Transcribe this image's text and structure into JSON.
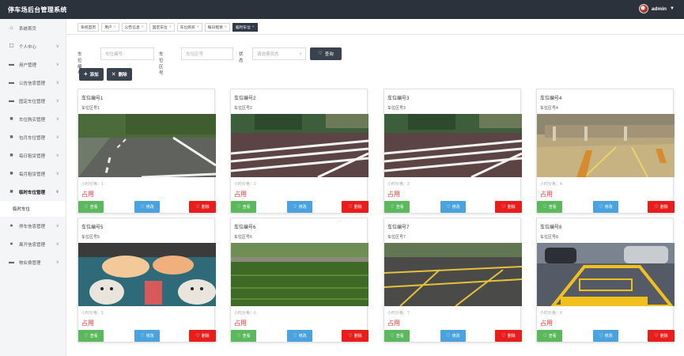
{
  "app": {
    "title": "停车场后台管理系统"
  },
  "user": {
    "name": "admin"
  },
  "sidebar": {
    "items": [
      {
        "label": "系统首页",
        "icon": "home-icon",
        "glyph": "⌂",
        "chevron": false
      },
      {
        "label": "个人中心",
        "icon": "user-icon",
        "glyph": "☐",
        "chevron": true
      },
      {
        "label": "用户管理",
        "icon": "users-icon",
        "glyph": "▬",
        "chevron": true
      },
      {
        "label": "公告信息管理",
        "icon": "notice-icon",
        "glyph": "▬",
        "chevron": true
      },
      {
        "label": "固定车位管理",
        "icon": "parking-icon",
        "glyph": "▬",
        "chevron": true
      },
      {
        "label": "车位购买管理",
        "icon": "grid-icon",
        "glyph": "■",
        "chevron": true
      },
      {
        "label": "包月车位管理",
        "icon": "grid-icon",
        "glyph": "■",
        "chevron": true
      },
      {
        "label": "每日租赁管理",
        "icon": "grid-icon",
        "glyph": "■",
        "chevron": true
      },
      {
        "label": "每月租赁管理",
        "icon": "grid-icon",
        "glyph": "■",
        "chevron": true
      },
      {
        "label": "临时车位管理",
        "icon": "grid-icon",
        "glyph": "■",
        "chevron": true,
        "active": true
      }
    ],
    "sub_item": "临时车位",
    "items_after": [
      {
        "label": "停车信息管理",
        "icon": "person-icon",
        "glyph": "●",
        "chevron": true
      },
      {
        "label": "离开信息管理",
        "icon": "exit-icon",
        "glyph": "●",
        "chevron": true
      },
      {
        "label": "物业费管理",
        "icon": "fee-icon",
        "glyph": "▬",
        "chevron": true
      }
    ]
  },
  "tabs": [
    {
      "label": "系统首页",
      "closable": false
    },
    {
      "label": "用户",
      "closable": true
    },
    {
      "label": "公告信息",
      "closable": true
    },
    {
      "label": "固定车位",
      "closable": true
    },
    {
      "label": "车位购买",
      "closable": true
    },
    {
      "label": "每日租赁",
      "closable": true
    },
    {
      "label": "临时车位",
      "closable": true,
      "active": true
    }
  ],
  "search": {
    "field1_label": "车位编号",
    "field1_placeholder": "车位编号",
    "field2_label": "车位区号",
    "field2_placeholder": "车位区号",
    "status_label": "状态",
    "status_placeholder": "请选择状态",
    "query_button": "查询"
  },
  "toolbar": {
    "add_label": "添加",
    "delete_label": "删除"
  },
  "card_labels": {
    "view": "查看",
    "edit": "修改",
    "delete": "删除"
  },
  "cards": [
    {
      "name": "车位编号1",
      "area": "车位区号1",
      "price": "小时价格：1",
      "status": "占用",
      "scene": "road"
    },
    {
      "name": "车位编号2",
      "area": "车位区号2",
      "price": "小时价格：2",
      "status": "占用",
      "scene": "brick"
    },
    {
      "name": "车位编号3",
      "area": "车位区号3",
      "price": "小时价格：3",
      "status": "占用",
      "scene": "brick"
    },
    {
      "name": "车位编号4",
      "area": "车位区号4",
      "price": "小时价格：4",
      "status": "占用",
      "scene": "garage"
    },
    {
      "name": "车位编号5",
      "area": "车位区号5",
      "price": "小时价格：5",
      "status": "占用",
      "scene": "cartoon"
    },
    {
      "name": "车位编号6",
      "area": "车位区号6",
      "price": "小时价格：6",
      "status": "占用",
      "scene": "grass"
    },
    {
      "name": "车位编号7",
      "area": "车位区号7",
      "price": "小时价格：7",
      "status": "占用",
      "scene": "asphalt"
    },
    {
      "name": "车位编号8",
      "area": "车位区号8",
      "price": "小时价格：8",
      "status": "占用",
      "scene": "yellow"
    }
  ]
}
